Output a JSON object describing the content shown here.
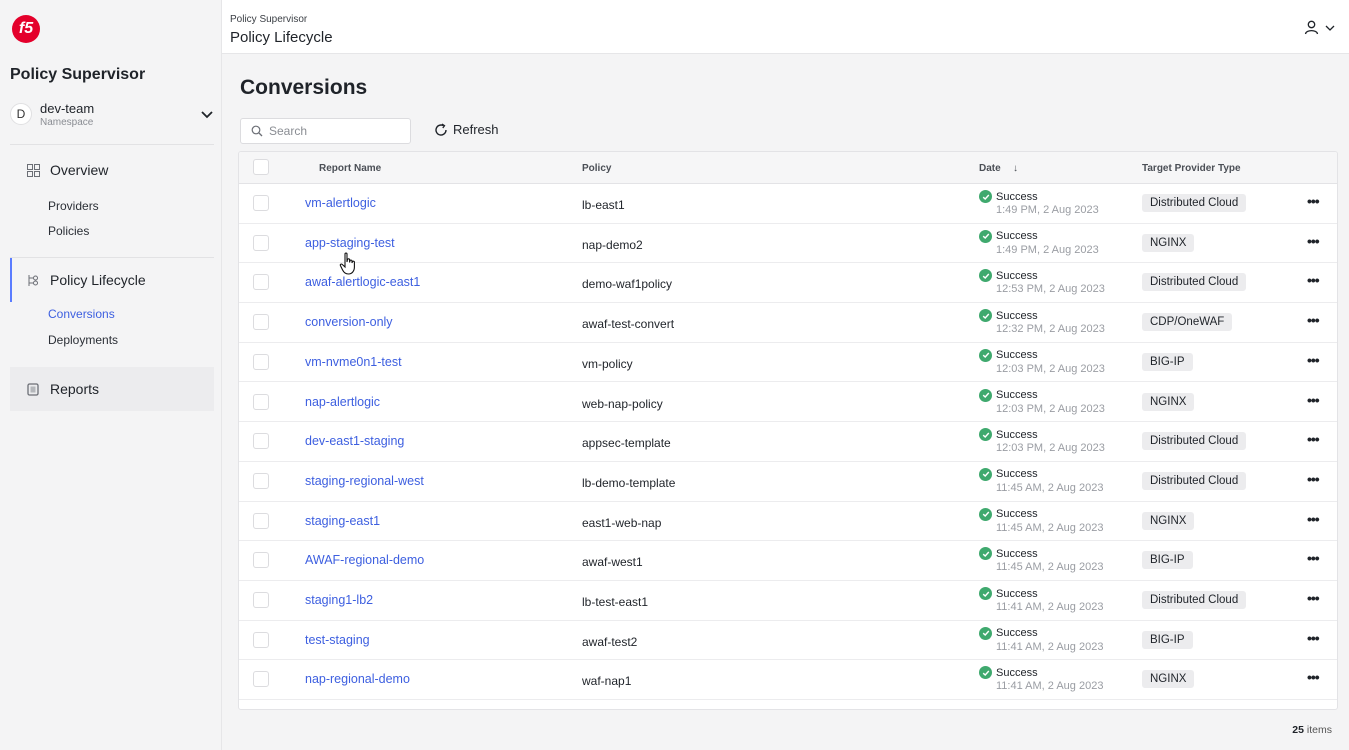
{
  "app": {
    "logo_text": "f5",
    "title": "Policy Supervisor"
  },
  "namespace": {
    "avatar": "D",
    "name": "dev-team",
    "label": "Namespace"
  },
  "nav": {
    "overview": "Overview",
    "providers": "Providers",
    "policies": "Policies",
    "policy_lifecycle": "Policy Lifecycle",
    "conversions": "Conversions",
    "deployments": "Deployments",
    "reports": "Reports"
  },
  "header": {
    "breadcrumb_parent": "Policy Supervisor",
    "breadcrumb_current": "Policy Lifecycle"
  },
  "page": {
    "title": "Conversions",
    "search_placeholder": "Search",
    "refresh_label": "Refresh",
    "items_count": "25",
    "items_label": "items"
  },
  "table": {
    "columns": {
      "report_name": "Report Name",
      "policy": "Policy",
      "date": "Date",
      "date_sort": "↓",
      "target": "Target Provider Type"
    },
    "rows": [
      {
        "name": "vm-alertlogic",
        "policy": "lb-east1",
        "status": "Success",
        "date": "1:49 PM, 2 Aug 2023",
        "target": "Distributed Cloud"
      },
      {
        "name": "app-staging-test",
        "policy": "nap-demo2",
        "status": "Success",
        "date": "1:49 PM, 2 Aug 2023",
        "target": "NGINX"
      },
      {
        "name": "awaf-alertlogic-east1",
        "policy": "demo-waf1policy",
        "status": "Success",
        "date": "12:53 PM, 2 Aug 2023",
        "target": "Distributed Cloud"
      },
      {
        "name": "conversion-only",
        "policy": "awaf-test-convert",
        "status": "Success",
        "date": "12:32 PM, 2 Aug 2023",
        "target": "CDP/OneWAF"
      },
      {
        "name": "vm-nvme0n1-test",
        "policy": "vm-policy",
        "status": "Success",
        "date": "12:03 PM, 2 Aug 2023",
        "target": "BIG-IP"
      },
      {
        "name": "nap-alertlogic",
        "policy": "web-nap-policy",
        "status": "Success",
        "date": "12:03 PM, 2 Aug 2023",
        "target": "NGINX"
      },
      {
        "name": "dev-east1-staging",
        "policy": "appsec-template",
        "status": "Success",
        "date": "12:03 PM, 2 Aug 2023",
        "target": "Distributed Cloud"
      },
      {
        "name": "staging-regional-west",
        "policy": "lb-demo-template",
        "status": "Success",
        "date": "11:45 AM, 2 Aug 2023",
        "target": "Distributed Cloud"
      },
      {
        "name": "staging-east1",
        "policy": "east1-web-nap",
        "status": "Success",
        "date": "11:45 AM, 2 Aug 2023",
        "target": "NGINX"
      },
      {
        "name": "AWAF-regional-demo",
        "policy": "awaf-west1",
        "status": "Success",
        "date": "11:45 AM, 2 Aug 2023",
        "target": "BIG-IP"
      },
      {
        "name": "staging1-lb2",
        "policy": "lb-test-east1",
        "status": "Success",
        "date": "11:41 AM, 2 Aug 2023",
        "target": "Distributed Cloud"
      },
      {
        "name": "test-staging",
        "policy": "awaf-test2",
        "status": "Success",
        "date": "11:41 AM, 2 Aug 2023",
        "target": "BIG-IP"
      },
      {
        "name": "nap-regional-demo",
        "policy": "waf-nap1",
        "status": "Success",
        "date": "11:41 AM, 2 Aug 2023",
        "target": "NGINX"
      }
    ],
    "more_label": "•••"
  },
  "colors": {
    "accent": "#3d5fe0",
    "success": "#3fa96e",
    "brand": "#e4002b"
  }
}
